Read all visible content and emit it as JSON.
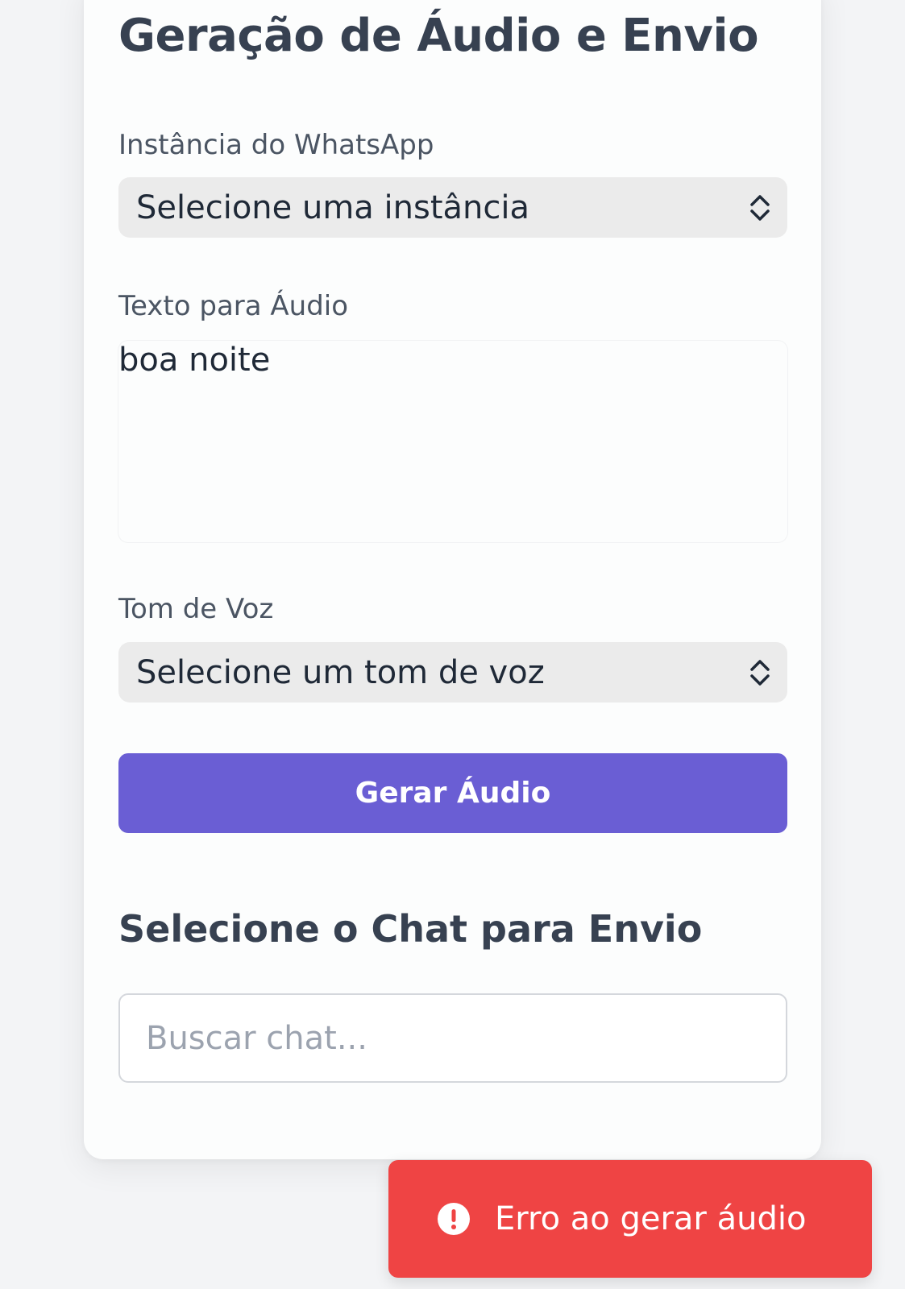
{
  "form": {
    "title": "Geração de Áudio e Envio",
    "instance_label": "Instância do WhatsApp",
    "instance_select": "Selecione uma instância",
    "text_label": "Texto para Áudio",
    "text_value": "boa noite",
    "voice_label": "Tom de Voz",
    "voice_select": "Selecione um tom de voz",
    "generate_button": "Gerar Áudio",
    "chat_section_title": "Selecione o Chat para Envio",
    "chat_search_placeholder": "Buscar chat..."
  },
  "toast": {
    "message": "Erro ao gerar áudio",
    "icon": "alert-circle-icon",
    "color": "#ef4444"
  },
  "colors": {
    "primary": "#6a5ed4",
    "error": "#ef4444",
    "background": "#f3f4f6"
  }
}
